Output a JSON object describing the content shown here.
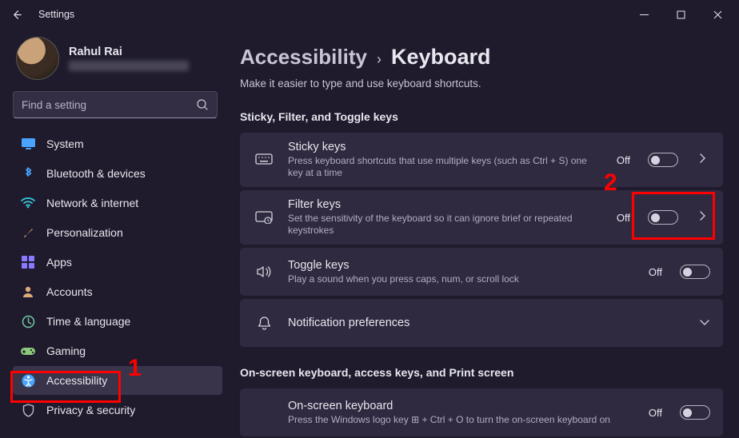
{
  "titlebar": {
    "title": "Settings"
  },
  "user": {
    "name": "Rahul Rai"
  },
  "search": {
    "placeholder": "Find a setting"
  },
  "sidebar": {
    "items": [
      {
        "label": "System"
      },
      {
        "label": "Bluetooth & devices"
      },
      {
        "label": "Network & internet"
      },
      {
        "label": "Personalization"
      },
      {
        "label": "Apps"
      },
      {
        "label": "Accounts"
      },
      {
        "label": "Time & language"
      },
      {
        "label": "Gaming"
      },
      {
        "label": "Accessibility"
      },
      {
        "label": "Privacy & security"
      }
    ]
  },
  "breadcrumb": {
    "parent": "Accessibility",
    "separator": "›",
    "current": "Keyboard"
  },
  "subtitle": "Make it easier to type and use keyboard shortcuts.",
  "section1": {
    "label": "Sticky, Filter, and Toggle keys",
    "cards": [
      {
        "title": "Sticky keys",
        "desc": "Press keyboard shortcuts that use multiple keys (such as Ctrl + S) one key at a time",
        "state": "Off"
      },
      {
        "title": "Filter keys",
        "desc": "Set the sensitivity of the keyboard so it can ignore brief or repeated keystrokes",
        "state": "Off"
      },
      {
        "title": "Toggle keys",
        "desc": "Play a sound when you press caps, num, or scroll lock",
        "state": "Off"
      },
      {
        "title": "Notification preferences",
        "desc": ""
      }
    ]
  },
  "section2": {
    "label": "On-screen keyboard, access keys, and Print screen",
    "cards": [
      {
        "title": "On-screen keyboard",
        "desc": "Press the Windows logo key ⊞ + Ctrl + O to turn the on-screen keyboard on",
        "state": "Off"
      }
    ]
  },
  "annotations": {
    "one": "1",
    "two": "2"
  }
}
